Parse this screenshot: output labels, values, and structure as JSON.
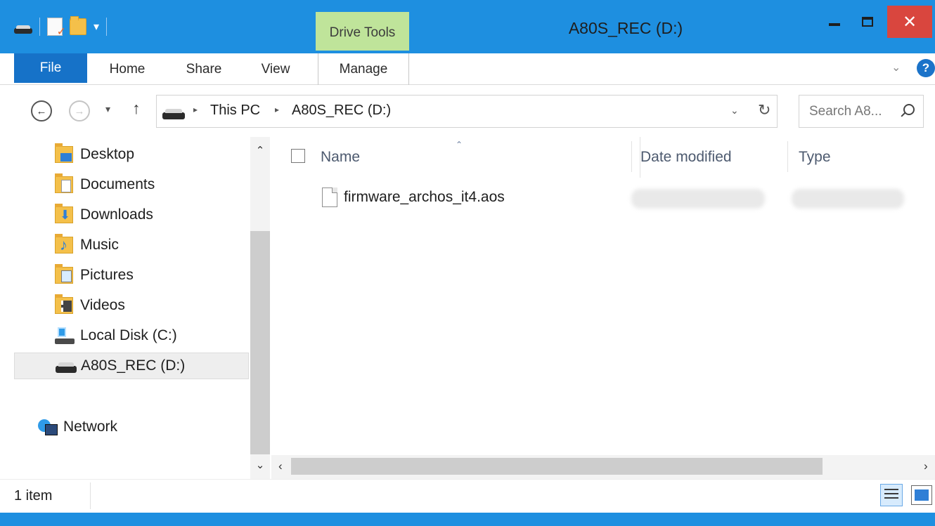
{
  "titlebar": {
    "context_tab": "Drive Tools",
    "title": "A80S_REC (D:)",
    "close_glyph": "✕",
    "qat_down": "▾"
  },
  "ribbon": {
    "tabs": [
      "File",
      "Home",
      "Share",
      "View",
      "Manage"
    ],
    "expand_glyph": "⌄",
    "help_glyph": "?"
  },
  "navbar": {
    "back_glyph": "←",
    "forward_glyph": "→",
    "recent_glyph": "▾",
    "up_glyph": "↑",
    "breadcrumb": [
      "This PC",
      "A80S_REC (D:)"
    ],
    "breadcrumb_sep": "▸",
    "dropdown_glyph": "⌄",
    "refresh_glyph": "↻",
    "search_placeholder": "Search A8..."
  },
  "sidebar": {
    "items": [
      {
        "label": "Desktop",
        "icon": "desktop-folder-icon"
      },
      {
        "label": "Documents",
        "icon": "documents-folder-icon"
      },
      {
        "label": "Downloads",
        "icon": "downloads-folder-icon"
      },
      {
        "label": "Music",
        "icon": "music-folder-icon"
      },
      {
        "label": "Pictures",
        "icon": "pictures-folder-icon"
      },
      {
        "label": "Videos",
        "icon": "videos-folder-icon"
      },
      {
        "label": "Local Disk (C:)",
        "icon": "local-disk-icon"
      },
      {
        "label": "A80S_REC (D:)",
        "icon": "removable-drive-icon",
        "selected": true
      }
    ],
    "network": {
      "label": "Network",
      "icon": "network-icon"
    },
    "scroll_up": "⌃",
    "scroll_down": "⌄"
  },
  "content": {
    "columns": [
      "Name",
      "Date modified",
      "Type"
    ],
    "sort_glyph": "⌃",
    "files": [
      {
        "name": "firmware_archos_it4.aos",
        "icon": "file-icon"
      }
    ],
    "scroll_left": "‹",
    "scroll_right": "›"
  },
  "status": {
    "item_count": "1 item"
  },
  "colors": {
    "titlebar": "#1e8fe0",
    "file_tab": "#1672c8",
    "drive_tools": "#bfe49a",
    "close_button": "#d9463e"
  }
}
